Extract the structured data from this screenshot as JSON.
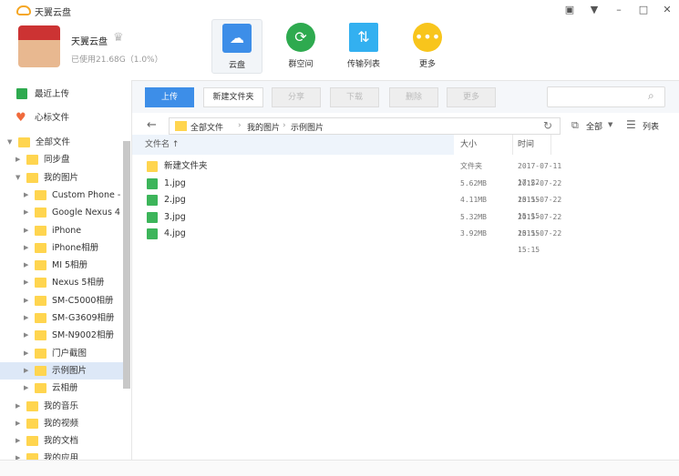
{
  "app": {
    "title": "天翼云盘"
  },
  "user": {
    "name": "天翼云盘",
    "usage": "已使用21.68G（1.0%）"
  },
  "nav": [
    {
      "label": "云盘",
      "color": "#3d8ee8"
    },
    {
      "label": "群空间",
      "color": "#2eaa4f"
    },
    {
      "label": "传输列表",
      "color": "#33b0f0"
    },
    {
      "label": "更多",
      "color": "#f8c51c"
    }
  ],
  "toolbar": {
    "upload": "上传",
    "new_folder": "新建文件夹",
    "share": "分享",
    "download": "下载",
    "delete": "删除",
    "more": "更多",
    "search_placeholder": ""
  },
  "breadcrumb": [
    "全部文件",
    "我的图片",
    "示例图片"
  ],
  "filter": "全部",
  "view": "列表",
  "columns": {
    "name": "文件名 ↑",
    "size": "大小",
    "time": "时间"
  },
  "files": [
    {
      "name": "新建文件夹",
      "size": "文件夹",
      "time": "2017-07-11 17:22",
      "type": "folder"
    },
    {
      "name": "1.jpg",
      "size": "5.62MB",
      "time": "2015-07-22 15:15",
      "type": "image"
    },
    {
      "name": "2.jpg",
      "size": "4.11MB",
      "time": "2015-07-22 15:15",
      "type": "image"
    },
    {
      "name": "3.jpg",
      "size": "5.32MB",
      "time": "2015-07-22 15:15",
      "type": "image"
    },
    {
      "name": "4.jpg",
      "size": "3.92MB",
      "time": "2015-07-22 15:15",
      "type": "image"
    }
  ],
  "sidebar": {
    "recent": "最近上传",
    "favorites": "心标文件",
    "tree": [
      {
        "label": "全部文件",
        "level": 0,
        "open": true
      },
      {
        "label": "同步盘",
        "level": 1
      },
      {
        "label": "我的图片",
        "level": 1,
        "open": true
      },
      {
        "label": "Custom Phone -",
        "level": 2
      },
      {
        "label": "Google Nexus 4",
        "level": 2
      },
      {
        "label": "iPhone",
        "level": 2
      },
      {
        "label": "iPhone相册",
        "level": 2
      },
      {
        "label": "MI 5相册",
        "level": 2
      },
      {
        "label": "Nexus 5相册",
        "level": 2
      },
      {
        "label": "SM-C5000相册",
        "level": 2
      },
      {
        "label": "SM-G3609相册",
        "level": 2
      },
      {
        "label": "SM-N9002相册",
        "level": 2
      },
      {
        "label": "门户截图",
        "level": 2
      },
      {
        "label": "示例图片",
        "level": 2,
        "selected": true
      },
      {
        "label": "云相册",
        "level": 2
      },
      {
        "label": "我的音乐",
        "level": 1
      },
      {
        "label": "我的视频",
        "level": 1
      },
      {
        "label": "我的文档",
        "level": 1
      },
      {
        "label": "我的应用",
        "level": 1
      }
    ]
  }
}
